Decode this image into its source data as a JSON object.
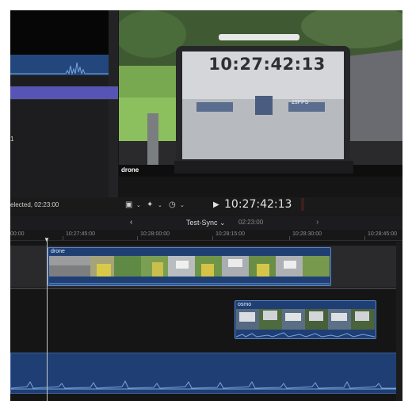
{
  "browser": {
    "row_number": "1"
  },
  "viewer": {
    "clip_name": "drone",
    "scene_timecode": "10:27:42:13",
    "scene_fps": "25FPS"
  },
  "toolbar": {
    "selection_info": "elected, 02:23:00",
    "timecode": "10:27:42:13",
    "icons": [
      "transform-icon",
      "chevron-down-icon",
      "magic-wand-icon",
      "speed-icon",
      "play-icon"
    ]
  },
  "timeline": {
    "project_name": "Test-Sync ⌄",
    "project_duration": "02:23:00",
    "nav_back": "‹",
    "nav_forward": "›",
    "ruler_labels": [
      "00:00",
      "10:27:45:00",
      "10:28:00:00",
      "10:28:15:00",
      "10:28:30:00",
      "10:28:45:00"
    ],
    "clips": [
      {
        "name": "drone"
      },
      {
        "name": "osmo"
      }
    ]
  },
  "colors": {
    "clip_fill": "#1f3f74",
    "clip_border": "#5a86c4",
    "selection": "#5655b5"
  }
}
